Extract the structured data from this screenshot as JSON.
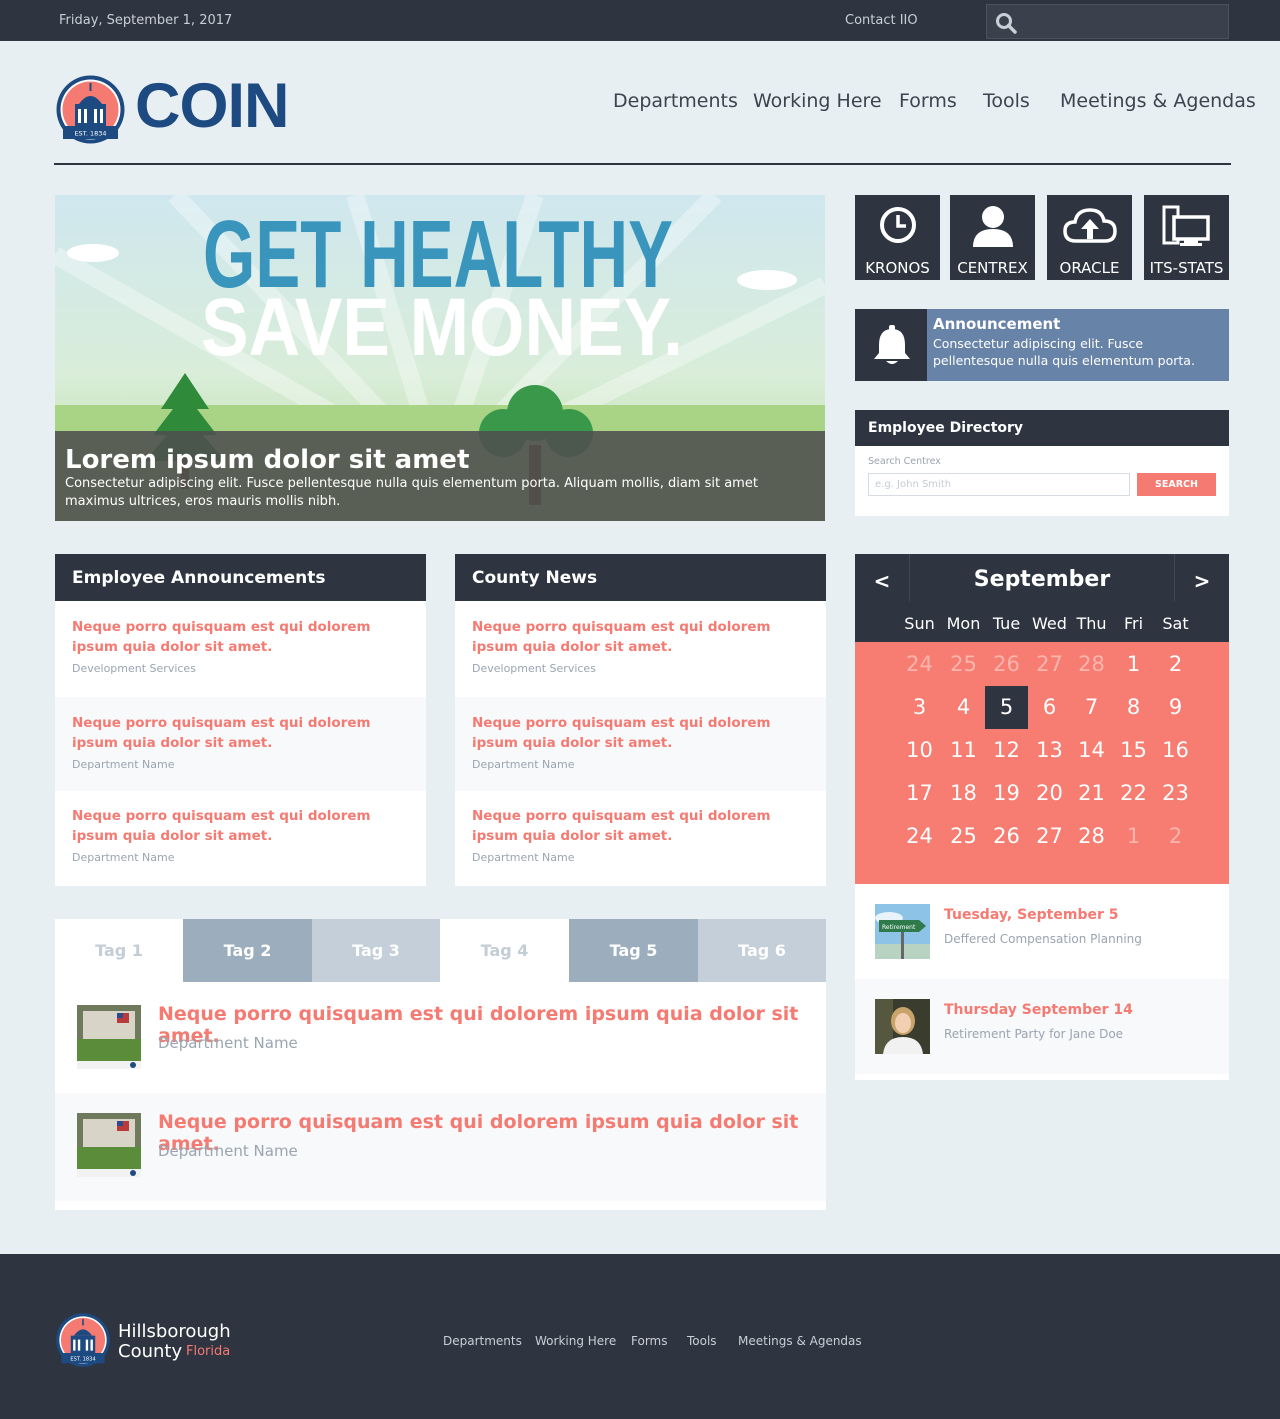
{
  "topbar": {
    "date": "Friday, September 1, 2017",
    "contact": "Contact IIO",
    "search_placeholder": ""
  },
  "header": {
    "brand": "COIN",
    "seal_text": "EST. 1834",
    "nav": [
      "Departments",
      "Working Here",
      "Forms",
      "Tools",
      "Meetings & Agendas"
    ]
  },
  "hero": {
    "banner_line1": "GET HEALTHY",
    "banner_line2": "SAVE MONEY.",
    "title": "Lorem ipsum dolor sit amet",
    "text": "Consectetur adipiscing elit. Fusce pellentesque nulla quis elementum porta. Aliquam mollis, diam sit amet maximus ultrices, eros mauris mollis nibh."
  },
  "tiles": [
    {
      "label": "KRONOS",
      "icon": "clock-icon"
    },
    {
      "label": "CENTREX",
      "icon": "user-icon"
    },
    {
      "label": "ORACLE",
      "icon": "cloud-upload-icon"
    },
    {
      "label": "ITS-STATS",
      "icon": "monitor-icon"
    }
  ],
  "announcement": {
    "icon": "bell-icon",
    "title": "Announcement",
    "text": "Consectetur adipiscing elit. Fusce pellentesque nulla quis elementum porta."
  },
  "directory": {
    "title": "Employee Directory",
    "label": "Search Centrex",
    "placeholder": "e.g. John Smith",
    "button": "SEARCH"
  },
  "employee_announcements": {
    "title": "Employee Announcements",
    "items": [
      {
        "title": "Neque porro quisquam est qui dolorem ipsum quia dolor sit amet.",
        "dept": "Development Services"
      },
      {
        "title": "Neque porro quisquam est qui dolorem ipsum quia dolor sit amet.",
        "dept": "Department Name"
      },
      {
        "title": "Neque porro quisquam est qui dolorem ipsum quia dolor sit amet.",
        "dept": "Department Name"
      }
    ]
  },
  "county_news": {
    "title": "County News",
    "items": [
      {
        "title": "Neque porro quisquam est qui dolorem ipsum quia dolor sit amet.",
        "dept": "Development Services"
      },
      {
        "title": "Neque porro quisquam est qui dolorem ipsum quia dolor sit amet.",
        "dept": "Department Name"
      },
      {
        "title": "Neque porro quisquam est qui dolorem ipsum quia dolor sit amet.",
        "dept": "Department Name"
      }
    ]
  },
  "tags": {
    "tabs": [
      "Tag 1",
      "Tag 2",
      "Tag 3",
      "Tag 4",
      "Tag 5",
      "Tag 6"
    ],
    "items": [
      {
        "title": "Neque porro quisquam est qui dolorem ipsum quia dolor sit amet.",
        "dept": "Department Name"
      },
      {
        "title": "Neque porro quisquam est qui dolorem ipsum quia dolor sit amet.",
        "dept": "Department Name"
      }
    ]
  },
  "calendar": {
    "prev": "<",
    "next": ">",
    "month": "September",
    "weekdays": [
      "Sun",
      "Mon",
      "Tue",
      "Wed",
      "Thu",
      "Fri",
      "Sat"
    ],
    "weeks": [
      [
        "24",
        "25",
        "26",
        "27",
        "28",
        "1",
        "2"
      ],
      [
        "3",
        "4",
        "5",
        "6",
        "7",
        "8",
        "9"
      ],
      [
        "10",
        "11",
        "12",
        "13",
        "14",
        "15",
        "16"
      ],
      [
        "17",
        "18",
        "19",
        "20",
        "21",
        "22",
        "23"
      ],
      [
        "24",
        "25",
        "26",
        "27",
        "28",
        "1",
        "2"
      ]
    ],
    "selected": "5",
    "colors": {
      "grid": "#f77d72",
      "muted": "#fbb5ad",
      "dark": "#2e3440"
    }
  },
  "events": [
    {
      "date": "Tuesday, September 5",
      "title": "Deffered Compensation Planning",
      "sign_text": "Retirement"
    },
    {
      "date": "Thursday September 14",
      "title": "Retirement Party for Jane Doe"
    }
  ],
  "footer": {
    "org_line1": "Hillsborough",
    "org_line2": "County",
    "org_state": "Florida",
    "nav": [
      "Departments",
      "Working Here",
      "Forms",
      "Tools",
      "Meetings & Agendas"
    ]
  }
}
